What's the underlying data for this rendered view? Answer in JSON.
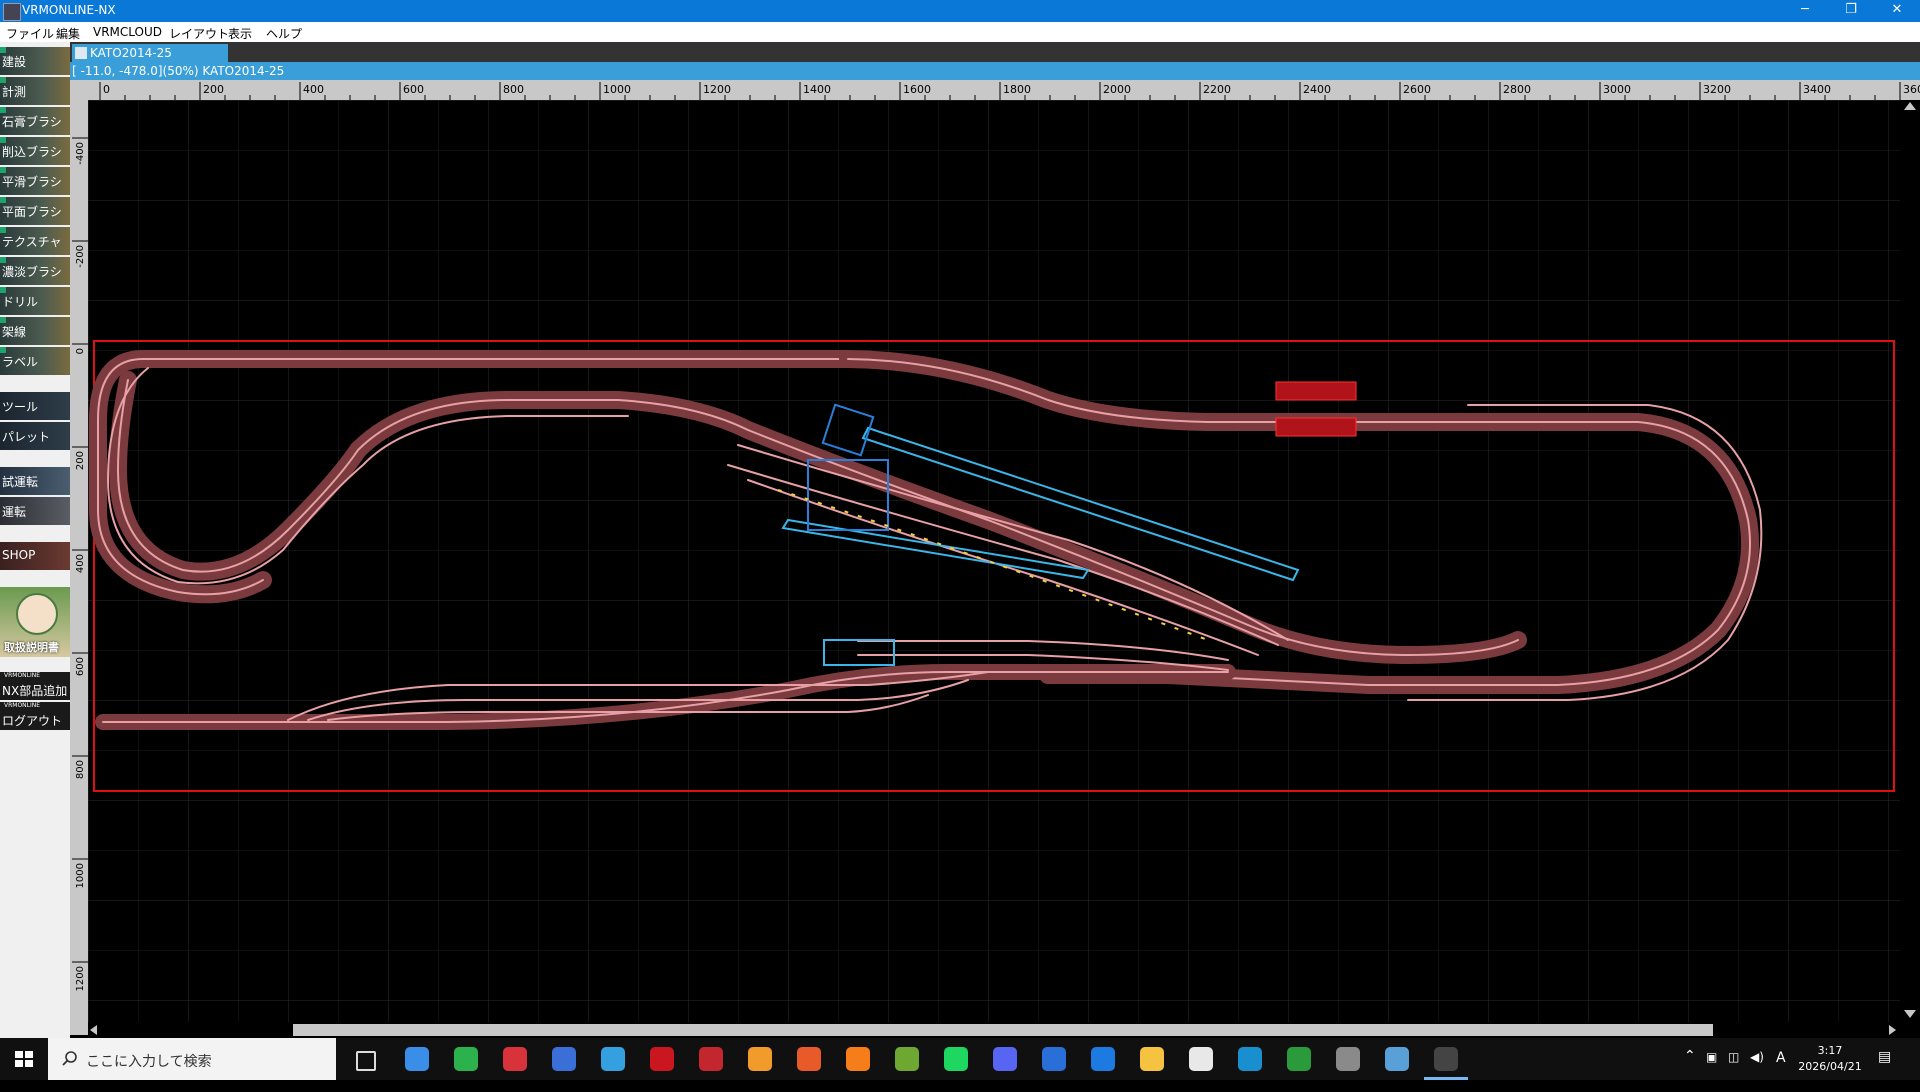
{
  "window": {
    "title": "VRMONLINE-NX",
    "minimize": "─",
    "restore": "❐",
    "close": "✕"
  },
  "menu": [
    "ファイル",
    "編集",
    "VRMCLOUD",
    "レイアウト",
    "表示",
    "ヘルプ"
  ],
  "sidebar": {
    "items": [
      "建設",
      "計測",
      "石膏ブラシ",
      "削込ブラシ",
      "平滑ブラシ",
      "平面ブラシ",
      "テクスチャ",
      "濃淡ブラシ",
      "ドリル",
      "架線",
      "ラベル",
      "ツール",
      "パレット",
      "試運転",
      "運転",
      "SHOP",
      "取扱説明書",
      "NX部品追加",
      "ログアウト"
    ],
    "sublabel": "VRMONLINE"
  },
  "tab": {
    "label": "KATO2014-25"
  },
  "status": {
    "coords": "[  -11.0, -478.0](50%) KATO2014-25"
  },
  "ruler": {
    "h_ticks": [
      "0",
      "200",
      "400",
      "600",
      "800",
      "1000",
      "1200",
      "1400",
      "1600",
      "1800",
      "2000",
      "2200",
      "2400",
      "2600",
      "2800",
      "3000",
      "3200",
      "3400",
      "360"
    ],
    "v_ticks": [
      "-400",
      "-200",
      "0",
      "200",
      "400",
      "600",
      "800",
      "1000",
      "1200"
    ]
  },
  "taskbar": {
    "search_placeholder": "ここに入力して検索",
    "time": "3:17",
    "date": "2026/04/21",
    "ime": "A",
    "icons": [
      "task-view",
      "copilot",
      "green-app",
      "red-app",
      "vivaldi",
      "browser-blue",
      "crosshair-app",
      "sw2023",
      "video",
      "swan-app",
      "blender",
      "green-box",
      "spotify",
      "discord",
      "widget-app",
      "blue-app",
      "file-explorer",
      "cards",
      "edge",
      "chrome",
      "camera",
      "rdp",
      "vrm-app"
    ]
  },
  "colors": {
    "titlebar": "#0a78d7",
    "track": "#e6a0a6",
    "layout_border": "#e01010",
    "station": "#3ab6e8"
  }
}
